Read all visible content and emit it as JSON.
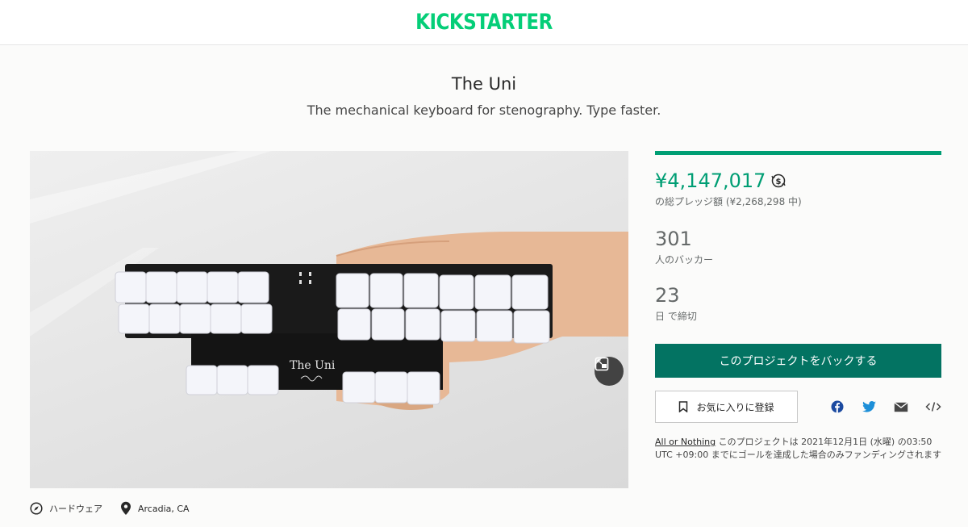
{
  "header": {
    "logo_text": "KICKSTARTER"
  },
  "project": {
    "title": "The Uni",
    "subtitle": "The mechanical keyboard for stenography. Type faster.",
    "video_device_label": "The Uni"
  },
  "meta": {
    "category_icon": "compass-icon",
    "category": "ハードウェア",
    "location_icon": "map-pin-icon",
    "location": "Arcadia, CA"
  },
  "stats": {
    "funding_progress": 1.0,
    "pledged": "¥4,147,017",
    "pledged_label": "の総プレッジ額 (¥2,268,298 中)",
    "backers": "301",
    "backers_label": "人のバッカー",
    "days": "23",
    "days_label": "日 で締切"
  },
  "actions": {
    "back_button": "このプロジェクトをバックする",
    "save_button": "お気に入りに登録"
  },
  "share": {
    "icons": [
      "facebook-icon",
      "twitter-icon",
      "email-icon",
      "embed-icon"
    ]
  },
  "funding_note": {
    "link": "All or Nothing",
    "text": " このプロジェクトは 2021年12月1日 (水曜) の03:50 UTC +09:00 までにゴールを達成した場合のみファンディングされます"
  },
  "colors": {
    "brand": "#05ce78",
    "accent": "#009e74",
    "button": "#037362",
    "muted": "#656969"
  }
}
